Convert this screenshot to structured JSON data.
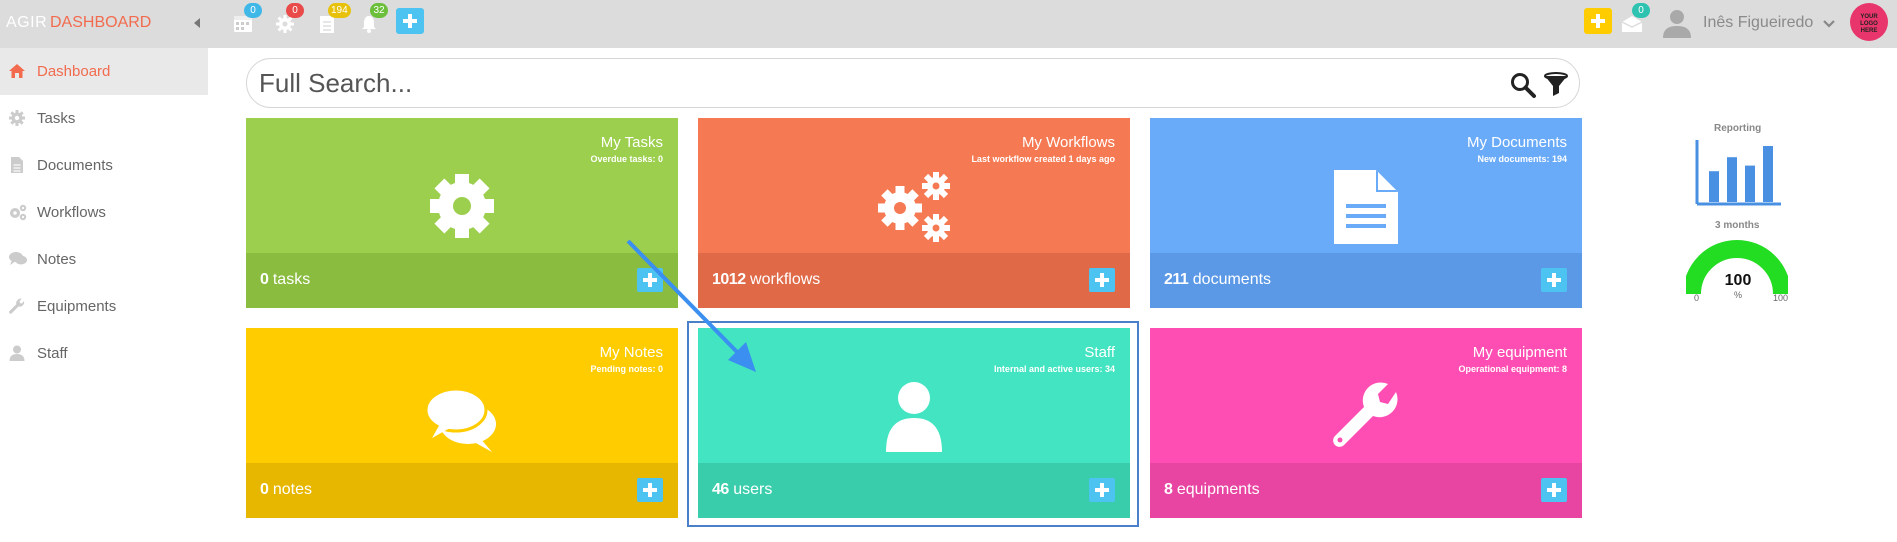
{
  "topbar": {
    "brand_short": "AGIR",
    "brand_title": "DASHBOARD",
    "badges": {
      "calendar": "0",
      "settings": "0",
      "documents": "194",
      "notifications": "32",
      "messages": "0"
    },
    "user_name": "Inês Figueiredo",
    "logo_text": [
      "YOUR",
      "LOGO",
      "HERE"
    ]
  },
  "sidebar": {
    "items": [
      {
        "label": "Dashboard",
        "icon": "home-icon",
        "active": true
      },
      {
        "label": "Tasks",
        "icon": "gear-icon",
        "active": false
      },
      {
        "label": "Documents",
        "icon": "document-icon",
        "active": false
      },
      {
        "label": "Workflows",
        "icon": "gears-icon",
        "active": false
      },
      {
        "label": "Notes",
        "icon": "chat-icon",
        "active": false
      },
      {
        "label": "Equipments",
        "icon": "wrench-icon",
        "active": false
      },
      {
        "label": "Staff",
        "icon": "user-icon",
        "active": false
      }
    ]
  },
  "search": {
    "placeholder": "Full Search..."
  },
  "tiles": [
    {
      "title": "My Tasks",
      "subtitle": "Overdue tasks: 0",
      "count": "0",
      "unit": "tasks",
      "color": "#9ccf4d",
      "bottom_color": "#89bc3f",
      "icon": "gear-icon"
    },
    {
      "title": "My Workflows",
      "subtitle": "Last workflow created 1 days ago",
      "count": "1012",
      "unit": "workflows",
      "color": "#f57a53",
      "bottom_color": "#e06a48",
      "icon": "gears-icon"
    },
    {
      "title": "My Documents",
      "subtitle": "New documents: 194",
      "count": "211",
      "unit": "documents",
      "color": "#6aabf9",
      "bottom_color": "#5b99e6",
      "icon": "document-icon"
    },
    {
      "title": "My Notes",
      "subtitle": "Pending notes: 0",
      "count": "0",
      "unit": "notes",
      "color": "#ffcc00",
      "bottom_color": "#e7b700",
      "icon": "chat-icon"
    },
    {
      "title": "Staff",
      "subtitle": "Internal and active users: 34",
      "count": "46",
      "unit": "users",
      "color": "#42e4c1",
      "bottom_color": "#39cdab",
      "icon": "user-icon"
    },
    {
      "title": "My equipment",
      "subtitle": "Operational equipment: 8",
      "count": "8",
      "unit": "equipments",
      "color": "#ff4eb3",
      "bottom_color": "#e845a2",
      "icon": "wrench-icon"
    }
  ],
  "reporting": {
    "label": "Reporting",
    "bars": [
      0.55,
      0.8,
      0.65,
      1.0
    ],
    "months_label": "3 months",
    "gauge_value": "100",
    "gauge_unit": "%",
    "gauge_min": "0",
    "gauge_max": "100",
    "gauge_color": "#22dd22"
  }
}
